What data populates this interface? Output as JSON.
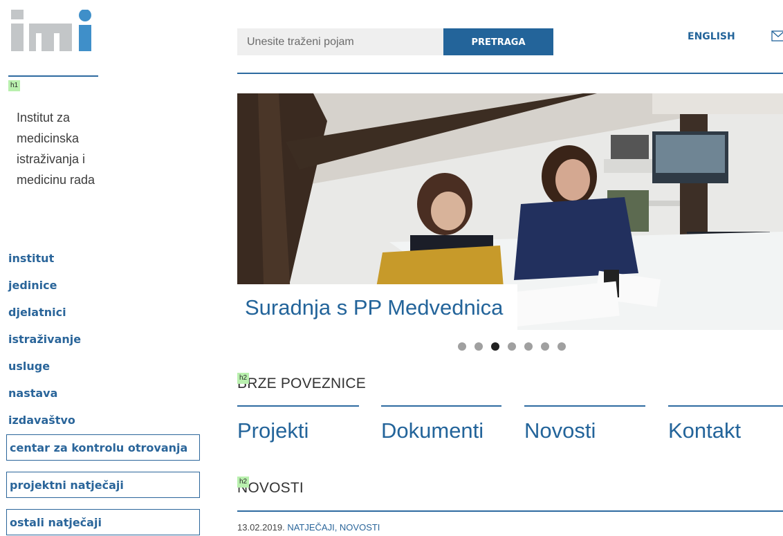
{
  "logo": {
    "text": "imi"
  },
  "institute_name": "Institut za medicinska istraživanja i medicinu rada",
  "badges": {
    "h1": "h1",
    "h2": "h2"
  },
  "nav": {
    "items": [
      "institut",
      "jedinice",
      "djelatnici",
      "istraživanje",
      "usluge",
      "nastava",
      "izdavaštvo"
    ],
    "boxed": [
      "centar za kontrolu otrovanja",
      "projektni natječaji",
      "ostali natječaji"
    ]
  },
  "search": {
    "placeholder": "Unesite traženi pojam",
    "button": "PRETRAGA"
  },
  "language": "ENGLISH",
  "slider": {
    "caption": "Suradnja s PP Medvednica",
    "dot_count": 7,
    "active_dot": 3
  },
  "quick_links": {
    "title": "BRZE POVEZNICE",
    "items": [
      "Projekti",
      "Dokumenti",
      "Novosti",
      "Kontakt"
    ]
  },
  "news": {
    "title": "NOVOSTI",
    "date": "13.02.2019.",
    "categories": "NATJEČAJI, NOVOSTI"
  },
  "colors": {
    "brand_blue": "#23649a",
    "logo_gray": "#c3c6c8",
    "logo_blue": "#3f8fc9"
  }
}
